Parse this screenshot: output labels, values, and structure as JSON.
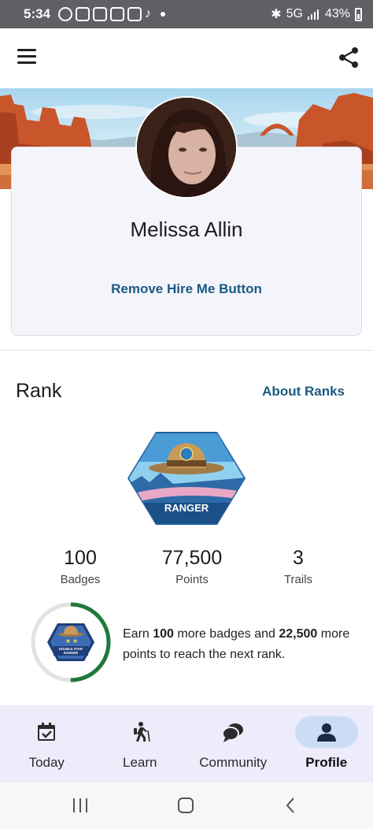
{
  "status_bar": {
    "time": "5:34",
    "network": "5G",
    "battery": "43%"
  },
  "profile": {
    "name": "Melissa Allin",
    "hire_button_label": "Remove Hire Me Button"
  },
  "rank": {
    "title": "Rank",
    "about_link": "About Ranks",
    "badge_title": "RANGER",
    "stats": [
      {
        "value": "100",
        "label": "Badges"
      },
      {
        "value": "77,500",
        "label": "Points"
      },
      {
        "value": "3",
        "label": "Trails"
      }
    ],
    "next_rank": {
      "badge_title": "DOUBLE STAR RANGER",
      "text_pre": "Earn ",
      "badges_needed": "100",
      "text_mid": " more badges and ",
      "points_needed": "22,500",
      "text_post": " more points to reach the next rank.",
      "progress": 0.5
    }
  },
  "bottom_nav": {
    "items": [
      {
        "label": "Today",
        "icon": "calendar-check-icon",
        "active": false
      },
      {
        "label": "Learn",
        "icon": "hiker-icon",
        "active": false
      },
      {
        "label": "Community",
        "icon": "chat-bubbles-icon",
        "active": false
      },
      {
        "label": "Profile",
        "icon": "person-icon",
        "active": true
      }
    ]
  },
  "colors": {
    "accent_link": "#1a5a82",
    "progress_ring": "#1e7a3c",
    "nav_background": "#ececfb",
    "nav_active_pill": "#cbdcf6"
  }
}
